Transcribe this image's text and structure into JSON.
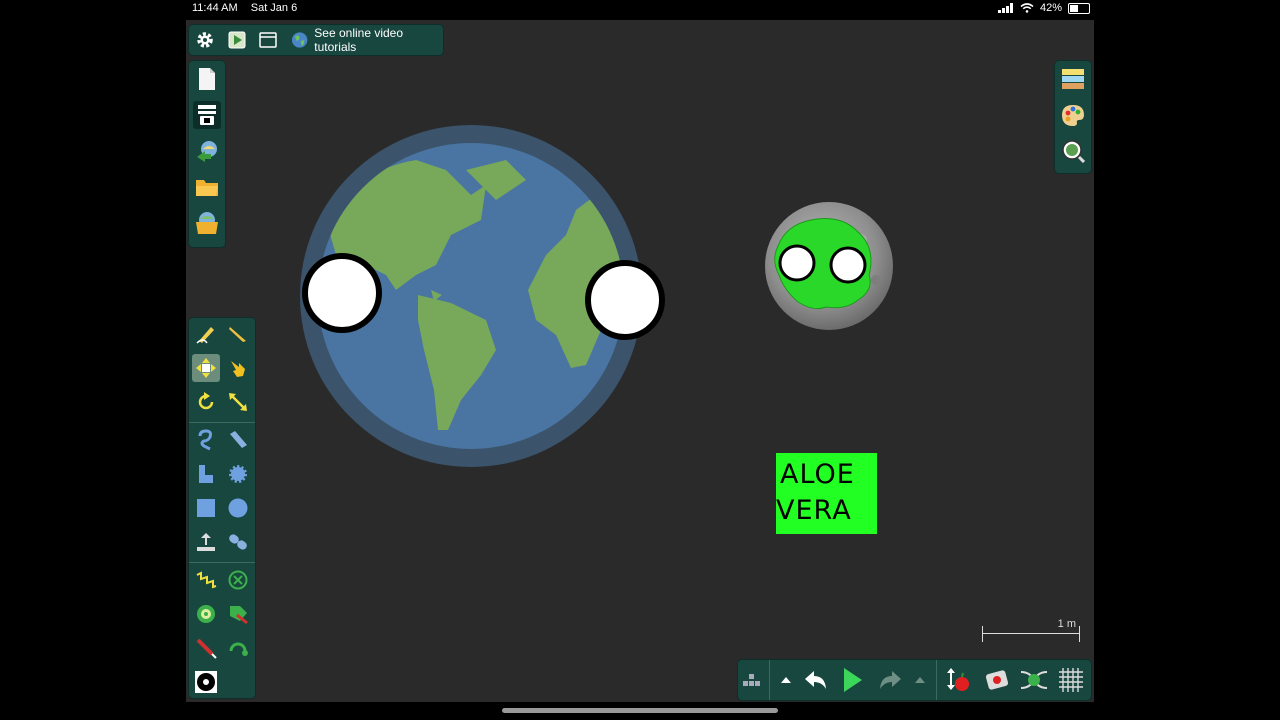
{
  "status": {
    "time": "11:44 AM",
    "date": "Sat Jan 6",
    "battery": "42%"
  },
  "top_toolbar": {
    "tutorial_label": "See online video tutorials"
  },
  "scene": {
    "aloe_text_line1": "ALOE",
    "aloe_text_line2": "VERA",
    "scale_label": "1 m"
  },
  "colors": {
    "panel": "#18473f",
    "canvas": "#2a2a2a",
    "ocean": "#4a75a2",
    "land": "#78a85a",
    "aloe_bg": "#22ff22",
    "play": "#3cd65a"
  },
  "icons": {
    "top": [
      "gear-icon",
      "play-scene-icon",
      "window-icon",
      "globe-icon"
    ],
    "file": [
      "new-scene-icon",
      "save-icon",
      "open-online-icon",
      "open-folder-icon",
      "open-browser-icon"
    ],
    "right": [
      "layers-icon",
      "palette-icon",
      "zoom-icon"
    ],
    "bottom": [
      "more-icon",
      "collapse-icon",
      "undo-icon",
      "play-icon",
      "redo-icon",
      "expand-icon",
      "gravity-icon",
      "fixate-icon",
      "mix-icon",
      "grid-icon"
    ]
  }
}
